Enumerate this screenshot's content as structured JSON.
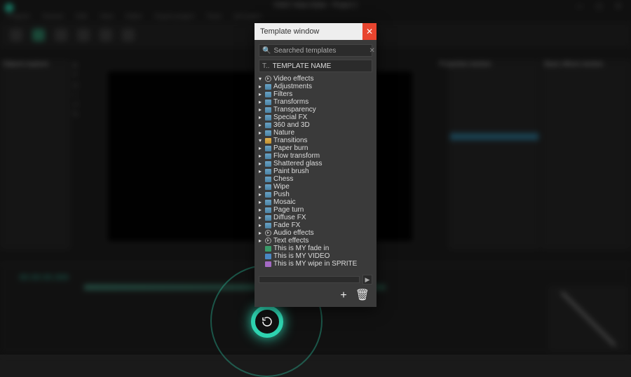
{
  "app": {
    "title": "VSDC Video Editor - Project 1"
  },
  "bg": {
    "menu": [
      "Projects",
      "Scenes",
      "Edit",
      "View",
      "Editor",
      "Export project",
      "Tools",
      "Activation"
    ],
    "left_panel": "Objects explorer",
    "right_panel1": "Properties window",
    "right_panel2": "Basic effects window",
    "timecode": "00:00:00.000"
  },
  "modal": {
    "title": "Template window",
    "search": {
      "placeholder": "",
      "value": "Searched templates"
    },
    "name_row": {
      "prefix": "T..",
      "value": "TEMPLATE NAME"
    },
    "add_icon": "+",
    "delete_icon": "🗑"
  },
  "tree": [
    {
      "depth": 0,
      "arrow": "down",
      "icon": "play",
      "label": "Video effects"
    },
    {
      "depth": 1,
      "arrow": "right",
      "icon": "folder",
      "label": "Adjustments"
    },
    {
      "depth": 1,
      "arrow": "right",
      "icon": "folder",
      "label": "Filters"
    },
    {
      "depth": 1,
      "arrow": "right",
      "icon": "folder",
      "label": "Transforms"
    },
    {
      "depth": 1,
      "arrow": "right",
      "icon": "folder",
      "label": "Transparency"
    },
    {
      "depth": 1,
      "arrow": "right",
      "icon": "folder",
      "label": "Special FX"
    },
    {
      "depth": 1,
      "arrow": "right",
      "icon": "folder",
      "label": "360 and 3D"
    },
    {
      "depth": 1,
      "arrow": "right",
      "icon": "folder",
      "label": "Nature"
    },
    {
      "depth": 1,
      "arrow": "down",
      "icon": "folder-o",
      "label": "Transitions"
    },
    {
      "depth": 2,
      "arrow": "right",
      "icon": "folder",
      "label": "Paper burn"
    },
    {
      "depth": 2,
      "arrow": "right",
      "icon": "folder",
      "label": "Flow transform"
    },
    {
      "depth": 2,
      "arrow": "right",
      "icon": "folder",
      "label": "Shattered glass"
    },
    {
      "depth": 2,
      "arrow": "right",
      "icon": "folder",
      "label": "Paint brush"
    },
    {
      "depth": 2,
      "arrow": "",
      "icon": "folder",
      "label": "Chess"
    },
    {
      "depth": 2,
      "arrow": "right",
      "icon": "folder",
      "label": "Wipe"
    },
    {
      "depth": 2,
      "arrow": "right",
      "icon": "folder",
      "label": "Push"
    },
    {
      "depth": 2,
      "arrow": "right",
      "icon": "folder",
      "label": "Mosaic"
    },
    {
      "depth": 2,
      "arrow": "right",
      "icon": "folder",
      "label": "Page turn"
    },
    {
      "depth": 2,
      "arrow": "right",
      "icon": "folder",
      "label": "Diffuse FX"
    },
    {
      "depth": 2,
      "arrow": "right",
      "icon": "folder",
      "label": "Fade FX"
    },
    {
      "depth": 0,
      "arrow": "right",
      "icon": "play",
      "label": "Audio effects"
    },
    {
      "depth": 0,
      "arrow": "right",
      "icon": "info",
      "label": "Text effects"
    },
    {
      "depth": 0,
      "arrow": "",
      "icon": "clip-g",
      "label": "This is MY fade in"
    },
    {
      "depth": 0,
      "arrow": "",
      "icon": "clip-b",
      "label": "This is MY VIDEO"
    },
    {
      "depth": 0,
      "arrow": "",
      "icon": "clip-p",
      "label": "This is MY wipe in SPRITE"
    }
  ]
}
